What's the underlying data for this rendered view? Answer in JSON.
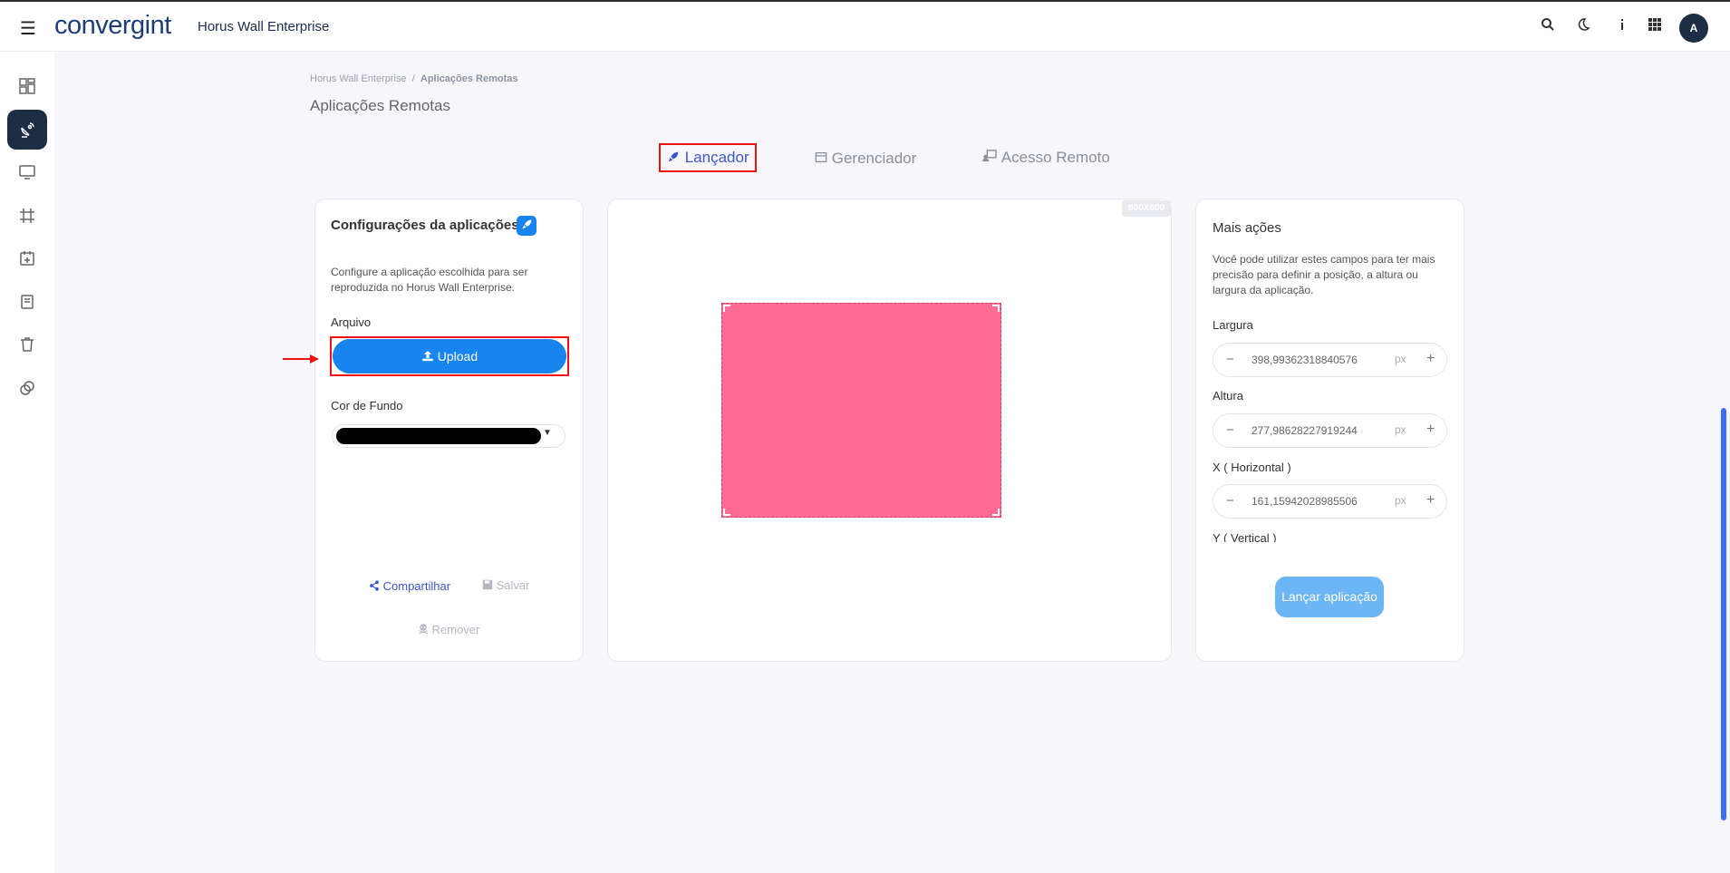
{
  "header": {
    "menu_icon": "hamburger-icon",
    "logo": "convergint",
    "app_name": "Horus Wall Enterprise",
    "avatar_initial": "A",
    "icons": [
      "search-icon",
      "moon-icon",
      "info-icon",
      "apps-grid-icon"
    ]
  },
  "sidebar": {
    "items": [
      {
        "icon": "dashboard-icon",
        "active": false
      },
      {
        "icon": "satellite-dish-icon",
        "active": true
      },
      {
        "icon": "monitor-icon",
        "active": false
      },
      {
        "icon": "crop-icon",
        "active": false
      },
      {
        "icon": "calendar-plus-icon",
        "active": false
      },
      {
        "icon": "book-icon",
        "active": false
      },
      {
        "icon": "trash-icon",
        "active": false
      },
      {
        "icon": "copy-icon",
        "active": false
      }
    ]
  },
  "breadcrumb": {
    "root": "Horus Wall Enterprise",
    "separator": "/",
    "current": "Aplicações Remotas"
  },
  "page_title": "Aplicações Remotas",
  "tabs": [
    {
      "label": "Lançador",
      "icon": "rocket-icon",
      "active": true
    },
    {
      "label": "Gerenciador",
      "icon": "window-icon",
      "active": false
    },
    {
      "label": "Acesso Remoto",
      "icon": "remote-desktop-icon",
      "active": false
    }
  ],
  "config_card": {
    "title": "Configurações da aplicações",
    "description": "Configure a aplicação escolhida para ser reproduzida no Horus Wall Enterprise.",
    "file_label": "Arquivo",
    "upload_label": "Upload",
    "background_label": "Cor de Fundo",
    "background_color": "#000000",
    "share_label": "Compartilhar",
    "save_label": "Salvar",
    "remove_label": "Remover"
  },
  "preview": {
    "resolution": "800X600",
    "app_color": "#ff6b93"
  },
  "actions_card": {
    "title": "Mais ações",
    "description": "Você pode utilizar estes campos para ter mais precisão para definir a posição, a altura ou largura da aplicação.",
    "fields": [
      {
        "label": "Largura",
        "value": "398,99362318840576",
        "unit": "px"
      },
      {
        "label": "Altura",
        "value": "277,98628227919244",
        "unit": "px"
      },
      {
        "label": "X ( Horizontal )",
        "value": "161,15942028985506",
        "unit": "px"
      }
    ],
    "next_label": "Y ( Vertical )",
    "launch_label": "Lançar aplicação"
  },
  "colors": {
    "accent": "#1784ef",
    "nav_dark": "#1d2d44",
    "highlight": "#e11111",
    "tab_active": "#3a58c9"
  }
}
